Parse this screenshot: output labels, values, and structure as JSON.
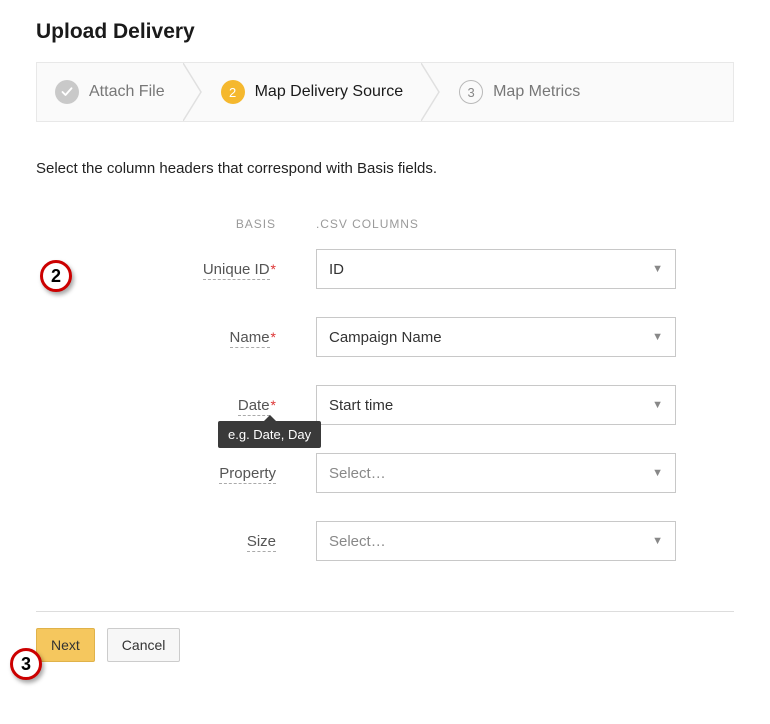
{
  "page_title": "Upload Delivery",
  "stepper": {
    "steps": [
      {
        "label": "Attach File",
        "state": "done"
      },
      {
        "label": "Map Delivery Source",
        "num": "2",
        "state": "active"
      },
      {
        "label": "Map Metrics",
        "num": "3",
        "state": "pending"
      }
    ]
  },
  "instructions": "Select the column headers that correspond with Basis fields.",
  "column_headers": {
    "basis": "BASIS",
    "csv": ".CSV COLUMNS"
  },
  "fields": {
    "unique_id": {
      "label": "Unique ID",
      "required": true,
      "value": "ID"
    },
    "name": {
      "label": "Name",
      "required": true,
      "value": "Campaign Name"
    },
    "date": {
      "label": "Date",
      "required": true,
      "value": "Start time",
      "tooltip": "e.g. Date, Day"
    },
    "property": {
      "label": "Property",
      "required": false,
      "placeholder": "Select…"
    },
    "size": {
      "label": "Size",
      "required": false,
      "placeholder": "Select…"
    }
  },
  "buttons": {
    "next": "Next",
    "cancel": "Cancel"
  },
  "callouts": {
    "two": "2",
    "three": "3"
  }
}
